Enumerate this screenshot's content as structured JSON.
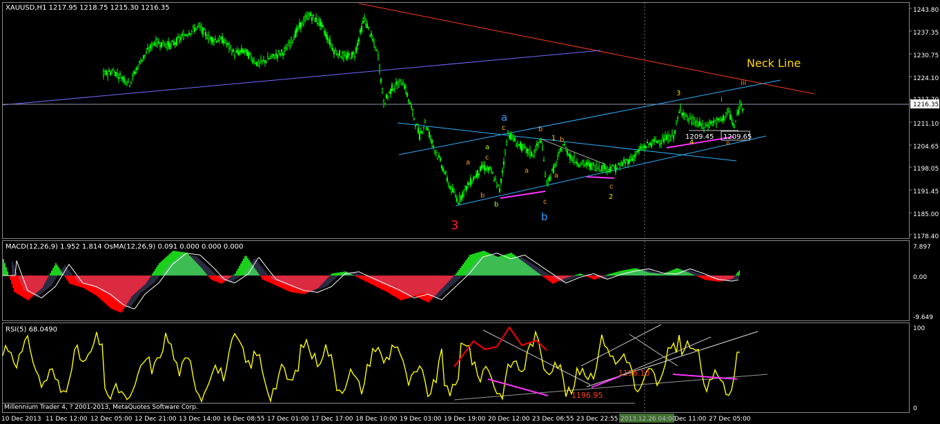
{
  "header": {
    "symbol_line": "XAUUSD,H1  1217.95 1218.75 1215.30 1216.35",
    "macd_line": "MACD(12,26,9) 1.952 1.814  OsMA(12,26,9) 0.091 0.000 0.000 0.000",
    "rsi_line": "RSI(5) 68.0490",
    "copyright": "Millennium Trader 4, ? 2001-2013, MetaQuotes Software Corp."
  },
  "price_axis": {
    "ticks": [
      "1243.80",
      "1237.35",
      "1230.75",
      "1224.10",
      "1217.70",
      "1211.10",
      "1204.65",
      "1198.05",
      "1191.45",
      "1185.00",
      "1178.40"
    ],
    "current_price": "1216.35"
  },
  "macd_axis": {
    "ticks": [
      "7.897",
      "0.00",
      "-9.649"
    ]
  },
  "rsi_axis": {
    "ticks": [
      "100",
      "0"
    ]
  },
  "time_axis": {
    "ticks": [
      "10 Dec 2013",
      "11 Dec 12:00",
      "12 Dec 05:00",
      "12 Dec 21:00",
      "13 Dec 14:00",
      "16 Dec 08:55",
      "17 Dec 01:00",
      "17 Dec 17:00",
      "18 Dec 10:00",
      "19 Dec 03:00",
      "19 Dec 19:00",
      "20 Dec 12:00",
      "23 Dec 06:55",
      "23 Dec 22:55",
      "2013.12.26 04:00",
      "Dec 11:00",
      "27 Dec 05:00"
    ],
    "highlighted": "2013.12.26 04:00"
  },
  "annotations": {
    "neck_line": "Neck Line",
    "wave_3_big": "3",
    "wave_a_blue": "a",
    "wave_b_blue": "b",
    "label_c1": "c",
    "label_a1": "a",
    "label_c2": "c",
    "label_b1": "b",
    "label_a2": "a",
    "label_b2": "b",
    "label_b3": "b",
    "label_1": "1",
    "label_b4": "b",
    "label_a3": "a",
    "label_a4": "a",
    "label_c3": "c",
    "label_c4": "c",
    "label_2": "2",
    "label_3": "3",
    "label_i": "i",
    "label_iii": "iii",
    "label_4": "4",
    "label_ii": "ii",
    "price_box_1": "1209.45",
    "price_box_2": "1209.65",
    "rsi_low_1": "1196.95",
    "rsi_low_2": "1196.10"
  },
  "colors": {
    "background": "#000000",
    "candles": "#00ff00",
    "neck_line": "#ff3b1a",
    "channel": "#2fb1ff",
    "support_line": "#6e6eff",
    "macd_up": "#1bd01b",
    "macd_down": "#ff0000",
    "macd_line": "#ffffff",
    "rsi": "#ffff00",
    "divergence": "#ff33ff",
    "neck_text": "#ffd700"
  },
  "chart_data": {
    "type": "line",
    "title": "XAUUSD,H1",
    "ohlc_last": {
      "open": 1217.95,
      "high": 1218.75,
      "low": 1215.3,
      "close": 1216.35
    },
    "ylim": [
      1178.4,
      1247.0
    ],
    "price_path": [
      [
        0,
        1247
      ],
      [
        15,
        1243.5
      ],
      [
        25,
        1241
      ],
      [
        35,
        1233
      ],
      [
        42,
        1228.5
      ],
      [
        55,
        1226.5
      ],
      [
        70,
        1225.5
      ],
      [
        80,
        1227
      ],
      [
        92,
        1223.5
      ],
      [
        100,
        1230
      ],
      [
        110,
        1235.5
      ],
      [
        122,
        1234.5
      ],
      [
        135,
        1238.5
      ],
      [
        142,
        1240
      ],
      [
        150,
        1236.5
      ],
      [
        160,
        1236
      ],
      [
        168,
        1232
      ],
      [
        175,
        1233
      ],
      [
        185,
        1229
      ],
      [
        195,
        1231
      ],
      [
        205,
        1233
      ],
      [
        215,
        1240
      ],
      [
        222,
        1243.5
      ],
      [
        230,
        1241
      ],
      [
        240,
        1233
      ],
      [
        248,
        1231
      ],
      [
        255,
        1232
      ],
      [
        262,
        1242.5
      ],
      [
        272,
        1231.5
      ],
      [
        276,
        1217.5
      ],
      [
        282,
        1222
      ],
      [
        290,
        1224
      ],
      [
        296,
        1216
      ],
      [
        302,
        1208
      ],
      [
        306,
        1212
      ],
      [
        312,
        1205
      ],
      [
        318,
        1199.5
      ],
      [
        324,
        1193
      ],
      [
        330,
        1189
      ],
      [
        336,
        1193
      ],
      [
        342,
        1196
      ],
      [
        348,
        1199
      ],
      [
        354,
        1197.5
      ],
      [
        360,
        1192
      ],
      [
        366,
        1209
      ],
      [
        372,
        1206
      ],
      [
        378,
        1204
      ],
      [
        384,
        1202.5
      ],
      [
        390,
        1207
      ],
      [
        394,
        1194
      ],
      [
        400,
        1199
      ],
      [
        406,
        1205.5
      ],
      [
        412,
        1201.5
      ],
      [
        418,
        1200
      ],
      [
        424,
        1199.5
      ],
      [
        430,
        1199
      ],
      [
        438,
        1198.5
      ],
      [
        444,
        1198.5
      ],
      [
        450,
        1200
      ],
      [
        456,
        1201.5
      ],
      [
        462,
        1204
      ],
      [
        468,
        1205.5
      ],
      [
        474,
        1206.5
      ],
      [
        480,
        1207
      ],
      [
        486,
        1208
      ],
      [
        491,
        1216
      ],
      [
        496,
        1213
      ],
      [
        502,
        1212
      ],
      [
        508,
        1210.5
      ],
      [
        514,
        1212
      ],
      [
        520,
        1212.5
      ],
      [
        526,
        1215
      ],
      [
        530,
        1210.5
      ],
      [
        534,
        1217
      ],
      [
        536,
        1216.35
      ]
    ],
    "key_levels": [
      {
        "name": "Neck Line",
        "value": 1224.1
      },
      {
        "name": "Current",
        "value": 1216.35
      },
      {
        "name": "Wave 3 low",
        "value": 1187.0
      }
    ],
    "macd": {
      "ylim": [
        -9.649,
        7.897
      ],
      "current": 1.952,
      "signal": 1.814
    },
    "rsi": {
      "ylim": [
        0,
        100
      ],
      "current": 68.049
    },
    "xlabel": "",
    "ylabel": ""
  }
}
